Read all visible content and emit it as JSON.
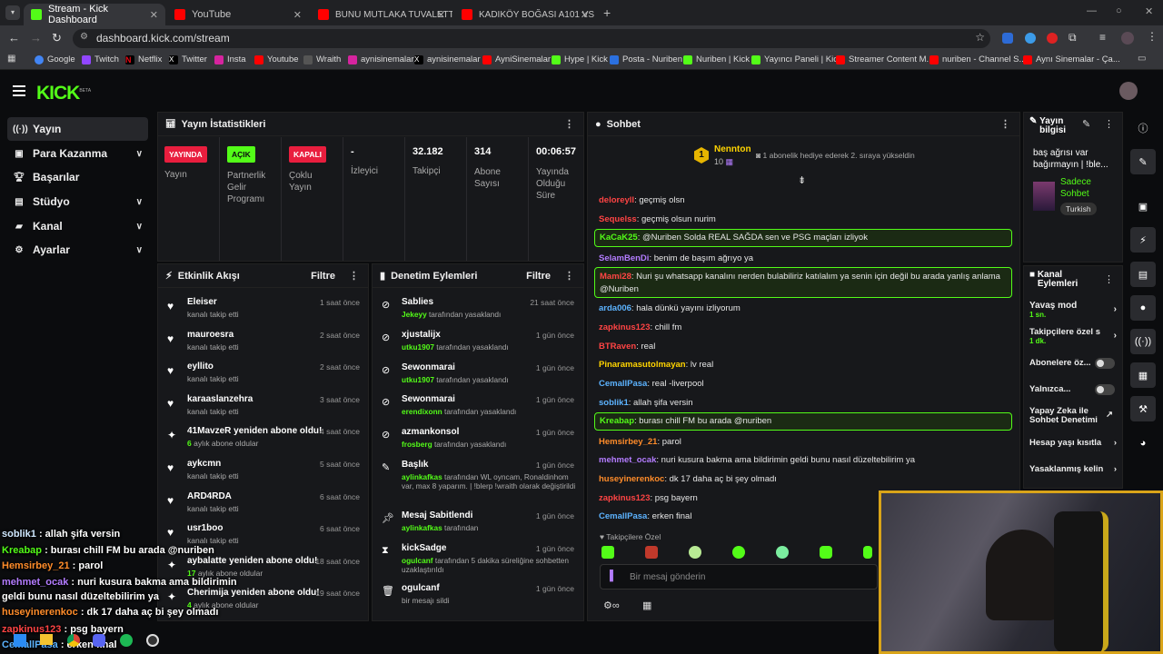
{
  "browser": {
    "tabs": [
      {
        "title": "Stream - Kick Dashboard",
        "active": true
      },
      {
        "title": "YouTube"
      },
      {
        "title": "BUNU MUTLAKA TUVALETTE KE"
      },
      {
        "title": "KADIKÖY BOĞASI A101 VS BİM"
      }
    ],
    "url": "dashboard.kick.com/stream",
    "bookmarks": [
      "Google",
      "Twitch",
      "Netflix",
      "Twitter",
      "Insta",
      "Youtube",
      "Wraith",
      "aynisinemalar",
      "aynisinemalar",
      "AyniSinemalar",
      "Hype | Kick",
      "Posta - Nuriben",
      "Nuriben | Kick",
      "Yayıncı Paneli | Kick",
      "Streamer Content M...",
      "nuriben - Channel S...",
      "Aynı Sinemalar - Ça..."
    ]
  },
  "app": {
    "logo": "KICK",
    "logo_beta": "BETA",
    "sidebar": [
      {
        "label": "Yayın",
        "icon": "stream-icon"
      },
      {
        "label": "Para Kazanma",
        "icon": "money-icon"
      },
      {
        "label": "Başarılar",
        "icon": "trophy-icon"
      },
      {
        "label": "Stüdyo",
        "icon": "studio-icon"
      },
      {
        "label": "Kanal",
        "icon": "channel-icon"
      },
      {
        "label": "Ayarlar",
        "icon": "settings-icon"
      }
    ]
  },
  "stats": {
    "title": "Yayın İstatistikleri",
    "items": [
      {
        "badge": "YAYINDA",
        "label": "Yayın"
      },
      {
        "badge": "AÇIK",
        "label": "Partnerlik Gelir Programı"
      },
      {
        "badge": "KAPALI",
        "label": "Çoklu Yayın"
      },
      {
        "value": "-",
        "label": "İzleyici"
      },
      {
        "value": "32.182",
        "label": "Takipçi"
      },
      {
        "value": "314",
        "label": "Abone Sayısı"
      },
      {
        "value": "00:06:57",
        "label": "Yayında Olduğu Süre"
      }
    ]
  },
  "activity": {
    "title": "Etkinlik Akışı",
    "filter": "Filtre",
    "items": [
      {
        "name": "Eleiser",
        "sub": "kanalı takip etti",
        "time": "1 saat önce"
      },
      {
        "name": "mauroesra",
        "sub": "kanalı takip etti",
        "time": "2 saat önce"
      },
      {
        "name": "eyllito",
        "sub": "kanalı takip etti",
        "time": "2 saat önce"
      },
      {
        "name": "karaaslanzehra",
        "sub": "kanalı takip etti",
        "time": "3 saat önce"
      },
      {
        "name": "41MavzeR yeniden abone oldu!",
        "sub_count": "6",
        "sub": " aylık abone oldular",
        "time": "4 saat önce"
      },
      {
        "name": "aykcmn",
        "sub": "kanalı takip etti",
        "time": "5 saat önce"
      },
      {
        "name": "ARD4RDA",
        "sub": "kanalı takip etti",
        "time": "6 saat önce"
      },
      {
        "name": "usr1boo",
        "sub": "kanalı takip etti",
        "time": "6 saat önce"
      },
      {
        "name": "aybalatte yeniden abone oldu!",
        "sub_count": "17",
        "sub": " aylık abone oldular",
        "time": "18 saat önce"
      },
      {
        "name": "Cherimija yeniden abone oldu!",
        "sub_count": "4",
        "sub": " aylık abone oldular",
        "time": "19 saat önce"
      }
    ]
  },
  "moderation": {
    "title": "Denetim Eylemleri",
    "filter": "Filtre",
    "items": [
      {
        "name": "Sablies",
        "actor": "Jekeyy",
        "sub": " tarafından yasaklandı",
        "time": "21 saat önce"
      },
      {
        "name": "xjustalijx",
        "actor": "utku1907",
        "sub": " tarafından yasaklandı",
        "time": "1 gün önce"
      },
      {
        "name": "Sewonmarai",
        "actor": "utku1907",
        "sub": " tarafından yasaklandı",
        "time": "1 gün önce"
      },
      {
        "name": "Sewonmarai",
        "actor": "erendixonn",
        "sub": " tarafından yasaklandı",
        "time": "1 gün önce"
      },
      {
        "name": "azmankonsol",
        "actor": "frosberg",
        "sub": " tarafından yasaklandı",
        "time": "1 gün önce"
      },
      {
        "name": "Başlık",
        "actor": "aylinkafkas",
        "sub": " tarafından WL oyncam, Ronaldinhom var, max 8 yaparım. | !blerp !wraith olarak değiştirildi",
        "time": "1 gün önce"
      },
      {
        "name": "Mesaj Sabitlendi",
        "actor": "aylinkafkas",
        "sub": " tarafından",
        "time": "1 gün önce"
      },
      {
        "name": "kickSadge",
        "actor": "ogulcanf",
        "sub": " tarafından 5 dakika süreliğine sohbetten uzaklaştırıldı",
        "time": "1 gün önce"
      },
      {
        "name": "ogulcanf",
        "actor": "",
        "sub": "bir mesajı sildi",
        "time": "1 gün önce"
      }
    ]
  },
  "chat": {
    "title": "Sohbet",
    "pinned_user": "Nennton",
    "pinned_count": "10",
    "pinned_text": "1 abonelik hediye ederek 2. sıraya yükseldin",
    "messages": [
      {
        "user": "deloreyll",
        "text": ": geçmiş olsn",
        "color": "#f44"
      },
      {
        "user": "Sequelss",
        "text": ": geçmiş olsun nurim",
        "color": "#f44"
      },
      {
        "user": "KaCaK25",
        "text": ": @Nuriben Solda REAL SAĞDA sen ve PSG maçları izliyok",
        "color": "#53fc18",
        "box": true
      },
      {
        "user": "SelamBenDi",
        "text": ": benim de başım ağrıyo ya",
        "color": "#b37cff"
      },
      {
        "user": "Mami28",
        "text": ": Nuri şu whatsapp kanalını nerden bulabiliriz katılalım ya senin için değil bu arada yanlış anlama",
        "text2": "@Nuriben",
        "color": "#f44",
        "box": true
      },
      {
        "user": "arda006",
        "text": ": hala dünkü yayını izliyorum",
        "color": "#5cb3ff"
      },
      {
        "user": "zapkinus123",
        "text": ": chill fm",
        "color": "#f44"
      },
      {
        "user": "BTRaven",
        "text": ": real",
        "color": "#f44"
      },
      {
        "user": "Pinaramasutolmayan",
        "text": ": lv real",
        "color": "#ffd400"
      },
      {
        "user": "CemallPasa",
        "text": ": real -liverpool",
        "color": "#5cb3ff"
      },
      {
        "user": "soblik1",
        "text": ": allah şifa versin",
        "color": "#5cb3ff"
      },
      {
        "user": "Kreabap",
        "text": ": burası chill FM bu arada @nuriben",
        "color": "#53fc18",
        "box": true
      },
      {
        "user": "Hemsirbey_21",
        "text": ": parol",
        "color": "#ff8c2a"
      },
      {
        "user": "mehmet_ocak",
        "text": ": nuri kusura bakma ama bildirimin geldi bunu nasıl düzeltebilirim ya",
        "color": "#b37cff"
      },
      {
        "user": "huseyinerenkoc",
        "text": ": dk 17 daha aç bi şey olmadı",
        "color": "#ff8c2a"
      },
      {
        "user": "zapkinus123",
        "text": ": psg bayern",
        "color": "#f44"
      },
      {
        "user": "CemallPasa",
        "text": ": erken final",
        "color": "#5cb3ff"
      }
    ],
    "followers_only": "Takipçilere Özel",
    "input_placeholder": "Bir mesaj gönderin"
  },
  "stream_info": {
    "title": "Yayın bilgisi",
    "stream_title": "baş ağrısı var bağırmayın | !ble...",
    "category": "Sadece Sohbet",
    "language": "Turkish"
  },
  "channel_actions": {
    "title": "Kanal Eylemleri",
    "items": [
      {
        "label": "Yavaş mod",
        "value": "1 sn."
      },
      {
        "label": "Takipçilere özel s",
        "value": "1 dk."
      },
      {
        "label": "Abonelere öz..."
      },
      {
        "label": "Yalnızca..."
      },
      {
        "label": "Yapay Zeka ile Sohbet Denetimi"
      },
      {
        "label": "Hesap yaşı kısıtla"
      },
      {
        "label": "Yasaklanmış kelin"
      }
    ]
  },
  "overlay_chat": [
    {
      "user": "soblik1",
      "text": " : allah şifa versin",
      "color": "#cfe8ff"
    },
    {
      "user": "Kreabap",
      "text": " : burası chill FM bu arada @nuriben",
      "color": "#53fc18"
    },
    {
      "user": "Hemsirbey_21",
      "text": " : parol",
      "color": "#ff8c2a"
    },
    {
      "user": "mehmet_ocak",
      "text": " : nuri kusura bakma ama bildirimin",
      "color": "#b37cff"
    },
    {
      "user": "",
      "text": "geldi bunu nasıl düzeltebilirim ya",
      "color": "#fff"
    },
    {
      "user": "huseyinerenkoc",
      "text": " : dk 17 daha aç bi şey olmadı",
      "color": "#ff8c2a"
    },
    {
      "user": "zapkinus123",
      "text": " : psg bayern",
      "color": "#f44"
    },
    {
      "user": "CemallPasa",
      "text": " : erken final",
      "color": "#5cb3ff"
    }
  ]
}
